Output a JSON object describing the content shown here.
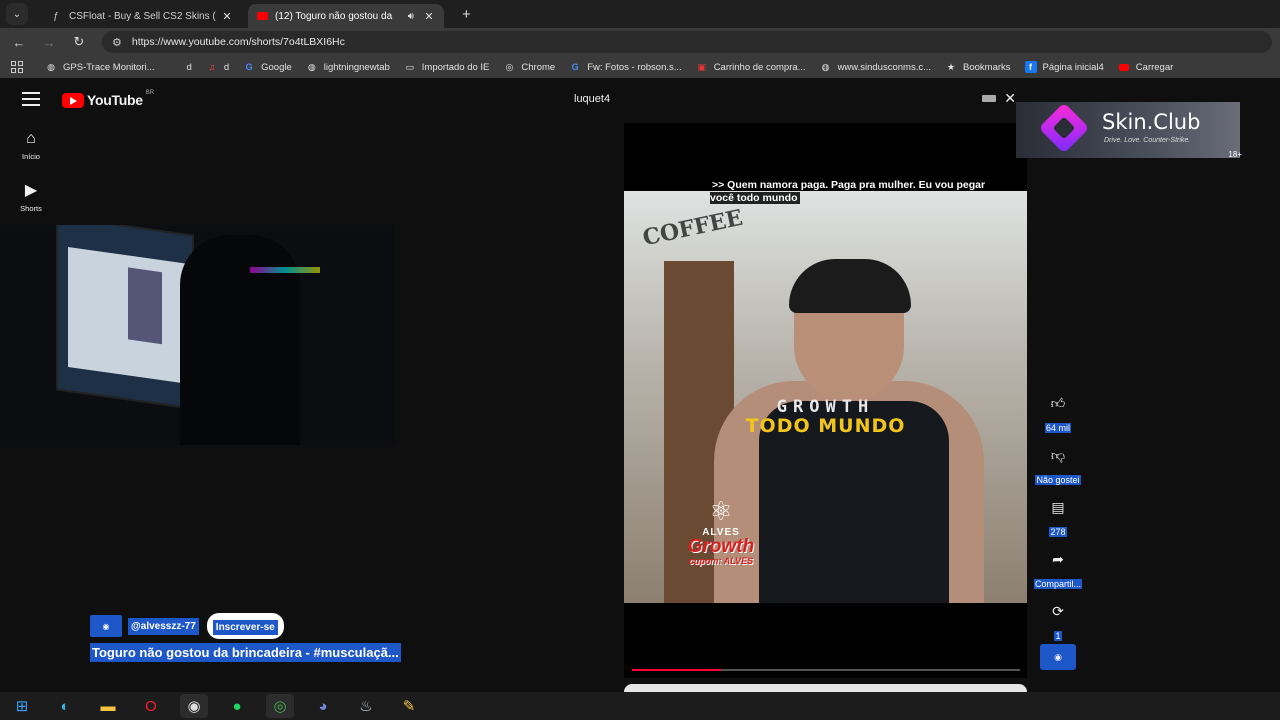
{
  "browser": {
    "tabs": [
      {
        "title": "CSFloat - Buy & Sell CS2 Skins (",
        "favicon": "csfloat-icon",
        "active": false
      },
      {
        "title": "(12) Toguro não gostou da",
        "favicon": "youtube-icon",
        "active": true
      }
    ],
    "url": "https://www.youtube.com/shorts/7o4tLBXI6Hc",
    "bookmarks": [
      {
        "label": "GPS-Trace Monitori...",
        "icon": "globe-icon"
      },
      {
        "label": "d",
        "icon": "blank-icon"
      },
      {
        "label": "d",
        "icon": "music-icon"
      },
      {
        "label": "Google",
        "icon": "google-icon"
      },
      {
        "label": "lightningnewtab",
        "icon": "globe-icon"
      },
      {
        "label": "Importado do IE",
        "icon": "folder-icon"
      },
      {
        "label": "Chrome",
        "icon": "chrome-icon"
      },
      {
        "label": "Fw: Fotos - robson.s...",
        "icon": "google-icon"
      },
      {
        "label": "Carrinho de compra...",
        "icon": "cart-icon"
      },
      {
        "label": "www.sindusconms.c...",
        "icon": "globe-icon"
      },
      {
        "label": "Bookmarks",
        "icon": "star-icon"
      },
      {
        "label": "Página inicial4",
        "icon": "facebook-icon"
      },
      {
        "label": "Carregar",
        "icon": "youtube-icon"
      }
    ]
  },
  "youtube": {
    "logo_text": "YouTube",
    "country": "BR",
    "sidebar": [
      {
        "label": "Início",
        "icon": "home-icon"
      },
      {
        "label": "Shorts",
        "icon": "shorts-icon"
      }
    ],
    "search_value": "luquet4"
  },
  "short": {
    "caption": ">> Quem namora paga. Paga pra mulher. Eu vou pegar você todo mundo",
    "sign_text": "COFFEE",
    "shirt_text": "GROWTH",
    "overlay_text": "TODO MUNDO",
    "brand": {
      "name": "ALVES",
      "product": "Growth",
      "coupon": "cupom: ALVES"
    },
    "progress": 0.23,
    "channel_handle": "@alvesszz-77",
    "subscribe_label": "Inscrever-se",
    "title": "Toguro não gostou da brincadeira - #musculaçã..."
  },
  "actions": [
    {
      "label": "64 mil",
      "icon": "like-icon"
    },
    {
      "label": "Não gostei",
      "icon": "dislike-icon"
    },
    {
      "label": "278",
      "icon": "comment-icon"
    },
    {
      "label": "Compartil...",
      "icon": "share-icon"
    },
    {
      "label": "1",
      "icon": "remix-icon"
    }
  ],
  "ad": {
    "name": "Skin.Club",
    "tagline": "Drive. Love. Counter-Strike.",
    "age": "18+"
  },
  "taskbar": [
    "windows-icon",
    "edge-icon",
    "explorer-icon",
    "opera-icon",
    "obs-icon",
    "spotify-icon",
    "chrome-icon",
    "discord-icon",
    "steam-icon",
    "app-icon"
  ]
}
